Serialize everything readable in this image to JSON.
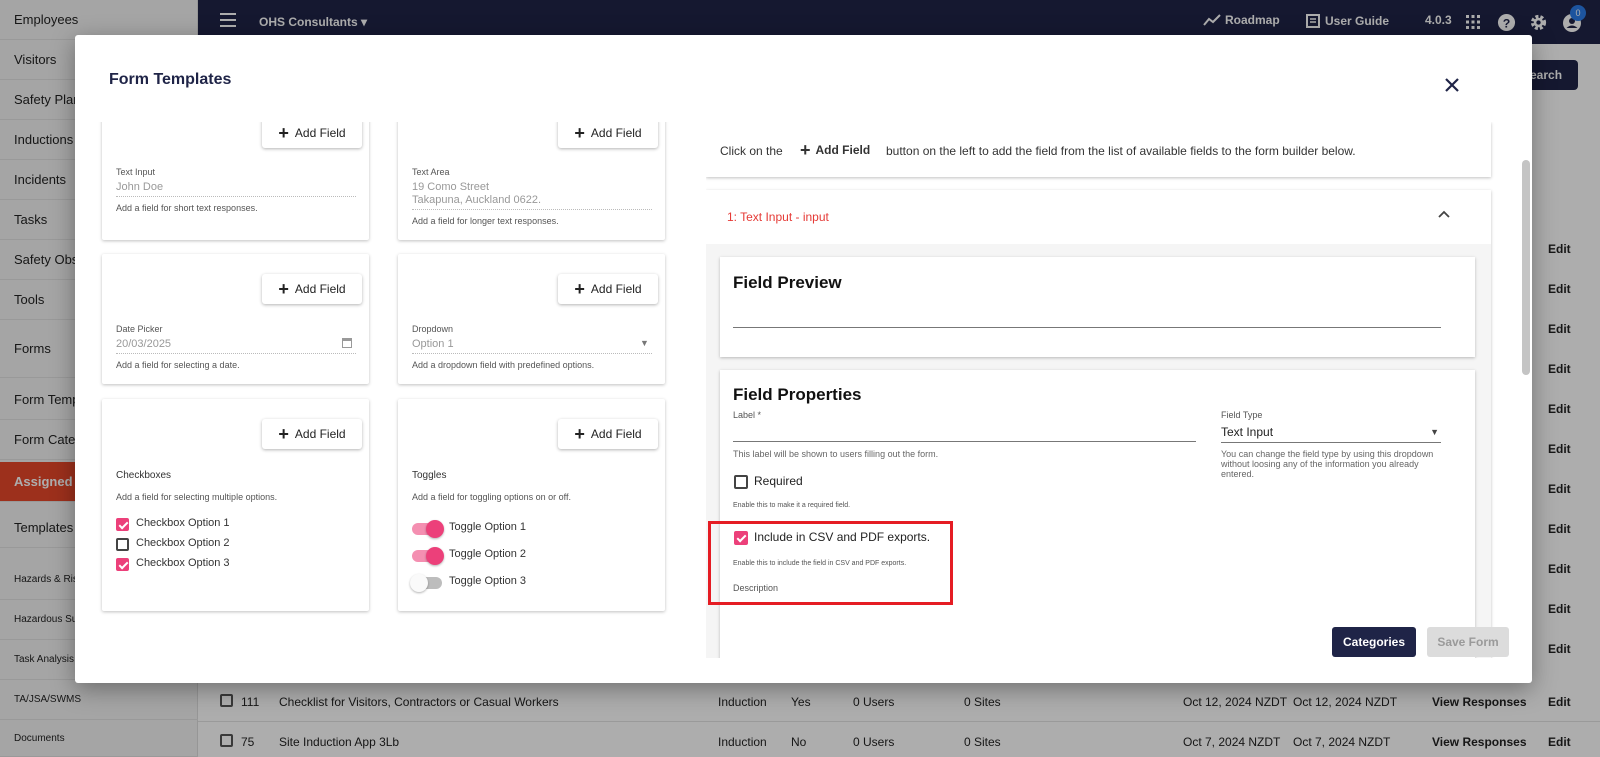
{
  "sidebar": {
    "items": [
      {
        "label": "Employees"
      },
      {
        "label": "Visitors"
      },
      {
        "label": "Safety Plans"
      },
      {
        "label": "Inductions"
      },
      {
        "label": "Incidents"
      },
      {
        "label": "Tasks"
      },
      {
        "label": "Safety Obs"
      },
      {
        "label": "Tools"
      },
      {
        "label": "Forms"
      },
      {
        "label": "Form Temp"
      },
      {
        "label": "Form Categ"
      },
      {
        "label": "Assigned F"
      },
      {
        "label": "Templates"
      },
      {
        "label": "Hazards & Risk"
      },
      {
        "label": "Hazardous Sub"
      },
      {
        "label": "Task Analysis D"
      },
      {
        "label": "TA/JSA/SWMS"
      },
      {
        "label": "Documents"
      }
    ]
  },
  "topbar": {
    "company": "OHS Consultants",
    "roadmap": "Roadmap",
    "user_guide": "User Guide",
    "version": "4.0.3",
    "notification_count": "0"
  },
  "background": {
    "search_button": "Search",
    "edit_label": "Edit",
    "rows": [
      {
        "id": "111",
        "name": "Checklist for Visitors, Contractors or Casual Workers",
        "type": "Induction",
        "active": "Yes",
        "users": "0 Users",
        "sites": "0 Sites",
        "created": "Oct 12, 2024 NZDT",
        "updated": "Oct 12, 2024 NZDT",
        "action": "View Responses",
        "edit": "Edit"
      },
      {
        "id": "75",
        "name": "Site Induction App 3Lb",
        "type": "Induction",
        "active": "No",
        "users": "0 Users",
        "sites": "0 Sites",
        "created": "Oct 7, 2024 NZDT",
        "updated": "Oct 7, 2024 NZDT",
        "action": "View Responses",
        "edit": "Edit"
      }
    ]
  },
  "modal": {
    "title": "Form Templates",
    "add_field_label": "Add Field",
    "fields": {
      "text_input": {
        "label": "Text Input",
        "value": "John Doe",
        "help": "Add a field for short text responses."
      },
      "text_area": {
        "label": "Text Area",
        "value_line1": "19 Como Street",
        "value_line2": "Takapuna, Auckland 0622.",
        "help": "Add a field for longer text responses."
      },
      "date_picker": {
        "label": "Date Picker",
        "value": "20/03/2025",
        "help": "Add a field for selecting a date."
      },
      "dropdown": {
        "label": "Dropdown",
        "value": "Option 1",
        "help": "Add a dropdown field with predefined options."
      },
      "checkboxes": {
        "label": "Checkboxes",
        "help": "Add a field for selecting multiple options.",
        "options": [
          {
            "label": "Checkbox Option 1",
            "checked": true
          },
          {
            "label": "Checkbox Option 2",
            "checked": false
          },
          {
            "label": "Checkbox Option 3",
            "checked": true
          }
        ]
      },
      "toggles": {
        "label": "Toggles",
        "help": "Add a field for toggling options on or off.",
        "options": [
          {
            "label": "Toggle Option 1",
            "on": true
          },
          {
            "label": "Toggle Option 2",
            "on": true
          },
          {
            "label": "Toggle Option 3",
            "on": false
          }
        ]
      }
    },
    "instructions": {
      "before": "Click on the",
      "button": "Add Field",
      "after": "button on the left to add the field from the list of available fields to the form builder below."
    },
    "builder": {
      "item_title": "1: Text Input - input",
      "preview_title": "Field Preview",
      "properties_title": "Field Properties",
      "label_field": {
        "label": "Label *",
        "value": "",
        "hint": "This label will be shown to users filling out the form."
      },
      "field_type": {
        "label": "Field Type",
        "value": "Text Input",
        "hint": "You can change the field type by using this dropdown without loosing any of the information you already entered."
      },
      "required": {
        "label": "Required",
        "checked": false,
        "hint": "Enable this to make it a required field."
      },
      "include_exports": {
        "label": "Include in CSV and PDF exports.",
        "checked": true,
        "hint": "Enable this to include the field in CSV and PDF exports."
      },
      "description_label": "Description"
    },
    "buttons": {
      "categories": "Categories",
      "save": "Save Form"
    }
  },
  "colors": {
    "navy": "#1f2447",
    "accent_pink": "#ec407a",
    "active_orange": "#e8472a",
    "highlight_red": "#e51c23",
    "item_title_red": "#e53935"
  }
}
